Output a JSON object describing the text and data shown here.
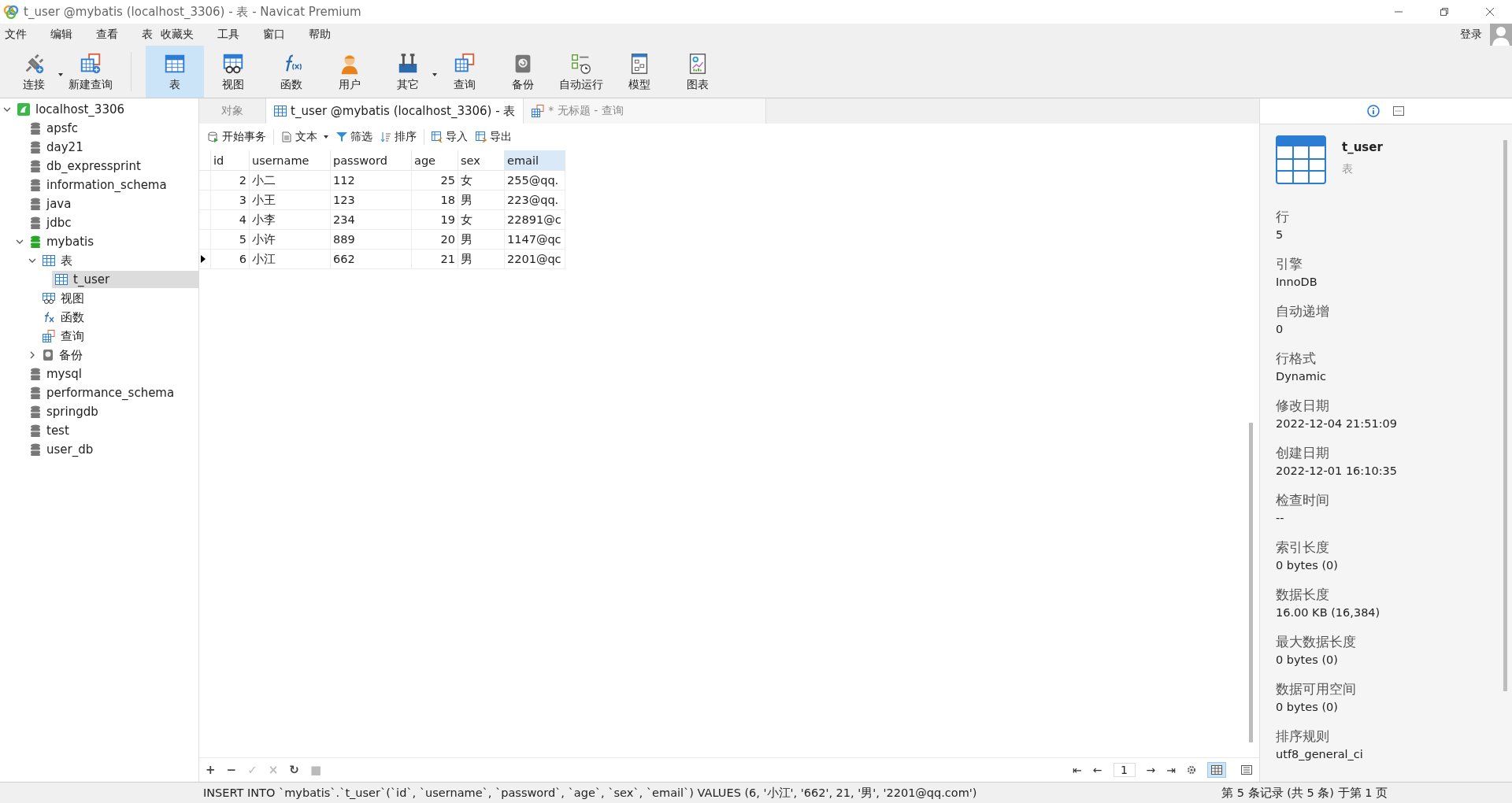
{
  "window": {
    "title": "t_user @mybatis (localhost_3306) - 表 - Navicat Premium"
  },
  "menu": [
    "文件",
    "编辑",
    "查看",
    "表",
    "收藏夹",
    "工具",
    "窗口",
    "帮助"
  ],
  "account": {
    "label": "登录"
  },
  "toolbar": [
    {
      "label": "连接",
      "kind": "connect",
      "selected": false,
      "dropdown": true
    },
    {
      "label": "新建查询",
      "kind": "newquery",
      "selected": false,
      "dropdown": false
    },
    {
      "label": "表",
      "kind": "table",
      "selected": true,
      "dropdown": false
    },
    {
      "label": "视图",
      "kind": "view",
      "selected": false,
      "dropdown": false
    },
    {
      "label": "函数",
      "kind": "function",
      "selected": false,
      "dropdown": false
    },
    {
      "label": "用户",
      "kind": "user",
      "selected": false,
      "dropdown": false
    },
    {
      "label": "其它",
      "kind": "tools",
      "selected": false,
      "dropdown": true
    },
    {
      "label": "查询",
      "kind": "query",
      "selected": false,
      "dropdown": false
    },
    {
      "label": "备份",
      "kind": "backup",
      "selected": false,
      "dropdown": false
    },
    {
      "label": "自动运行",
      "kind": "schedule",
      "selected": false,
      "dropdown": false
    },
    {
      "label": "模型",
      "kind": "model",
      "selected": false,
      "dropdown": false
    },
    {
      "label": "图表",
      "kind": "chart",
      "selected": false,
      "dropdown": false
    }
  ],
  "tree": [
    {
      "label": "localhost_3306",
      "kind": "server",
      "expanded": true,
      "children": [
        {
          "label": "apsfc",
          "kind": "database",
          "active": false,
          "selected": false
        },
        {
          "label": "day21",
          "kind": "database",
          "active": false,
          "selected": false
        },
        {
          "label": "db_expressprint",
          "kind": "database",
          "active": false,
          "selected": false
        },
        {
          "label": "information_schema",
          "kind": "database",
          "active": false,
          "selected": false
        },
        {
          "label": "java",
          "kind": "database",
          "active": false,
          "selected": false
        },
        {
          "label": "jdbc",
          "kind": "database",
          "active": false,
          "selected": false
        },
        {
          "label": "mybatis",
          "kind": "database",
          "active": true,
          "selected": false,
          "expanded": true,
          "children": [
            {
              "label": "表",
              "kind": "tables",
              "expanded": true,
              "selected": false,
              "children": [
                {
                  "label": "t_user",
                  "kind": "table",
                  "selected": true
                }
              ]
            },
            {
              "label": "视图",
              "kind": "views",
              "selected": false
            },
            {
              "label": "函数",
              "kind": "functions",
              "selected": false
            },
            {
              "label": "查询",
              "kind": "queries",
              "selected": false
            },
            {
              "label": "备份",
              "kind": "backups",
              "expanded": false,
              "selected": false
            }
          ]
        },
        {
          "label": "mysql",
          "kind": "database",
          "active": false,
          "selected": false
        },
        {
          "label": "performance_schema",
          "kind": "database",
          "active": false,
          "selected": false
        },
        {
          "label": "springdb",
          "kind": "database",
          "active": false,
          "selected": false
        },
        {
          "label": "test",
          "kind": "database",
          "active": false,
          "selected": false
        },
        {
          "label": "user_db",
          "kind": "database",
          "active": false,
          "selected": false
        }
      ]
    }
  ],
  "tabs": [
    {
      "label": "对象",
      "kind": "objects",
      "selected": false
    },
    {
      "label": "t_user @mybatis (localhost_3306) - 表",
      "kind": "table",
      "selected": true
    },
    {
      "label": "* 无标题 - 查询",
      "kind": "query",
      "selected": false
    }
  ],
  "data_toolbar": [
    {
      "label": "开始事务",
      "kind": "transaction",
      "dropdown": false
    },
    {
      "label": "文本",
      "kind": "text",
      "dropdown": true
    },
    {
      "label": "筛选",
      "kind": "filter",
      "dropdown": false
    },
    {
      "label": "排序",
      "kind": "sort",
      "dropdown": false
    },
    {
      "label": "导入",
      "kind": "import",
      "dropdown": false
    },
    {
      "label": "导出",
      "kind": "export",
      "dropdown": false
    }
  ],
  "grid": {
    "columns": [
      {
        "label": "id",
        "selected": false
      },
      {
        "label": "username",
        "selected": false
      },
      {
        "label": "password",
        "selected": false
      },
      {
        "label": "age",
        "selected": false
      },
      {
        "label": "sex",
        "selected": false
      },
      {
        "label": "email",
        "selected": true
      }
    ],
    "rows": [
      {
        "current": false,
        "cells": [
          "2",
          "小二",
          "112",
          "25",
          "女",
          "255@qq."
        ]
      },
      {
        "current": false,
        "cells": [
          "3",
          "小王",
          "123",
          "18",
          "男",
          "223@qq."
        ]
      },
      {
        "current": false,
        "cells": [
          "4",
          "小李",
          "234",
          "19",
          "女",
          "22891@c"
        ]
      },
      {
        "current": false,
        "cells": [
          "5",
          "小许",
          "889",
          "20",
          "男",
          "1147@qc"
        ]
      },
      {
        "current": true,
        "cells": [
          "6",
          "小江",
          "662",
          "21",
          "男",
          "2201@qc"
        ]
      }
    ]
  },
  "edit_buttons": [
    {
      "symbol": "+",
      "disabled": false
    },
    {
      "symbol": "−",
      "disabled": false
    },
    {
      "symbol": "✓",
      "disabled": true
    },
    {
      "symbol": "×",
      "disabled": true
    },
    {
      "symbol": "↻",
      "disabled": false
    },
    {
      "symbol": "■",
      "disabled": true
    }
  ],
  "pager": {
    "page": "1",
    "buttons": [
      "⇤",
      "←",
      "→",
      "⇥"
    ]
  },
  "view_modes": [
    {
      "kind": "grid",
      "selected": true
    },
    {
      "kind": "form",
      "selected": false
    }
  ],
  "info_tabs": [
    {
      "kind": "info",
      "selected": true
    },
    {
      "kind": "ddl",
      "selected": false
    }
  ],
  "info": {
    "name": "t_user",
    "type": "表",
    "fields": [
      {
        "label": "行",
        "value": "5"
      },
      {
        "label": "引擎",
        "value": "InnoDB"
      },
      {
        "label": "自动递增",
        "value": "0"
      },
      {
        "label": "行格式",
        "value": "Dynamic"
      },
      {
        "label": "修改日期",
        "value": "2022-12-04 21:51:09"
      },
      {
        "label": "创建日期",
        "value": "2022-12-01 16:10:35"
      },
      {
        "label": "检查时间",
        "value": "--"
      },
      {
        "label": "索引长度",
        "value": "0 bytes (0)"
      },
      {
        "label": "数据长度",
        "value": "16.00 KB (16,384)"
      },
      {
        "label": "最大数据长度",
        "value": "0 bytes (0)"
      },
      {
        "label": "数据可用空间",
        "value": "0 bytes (0)"
      },
      {
        "label": "排序规则",
        "value": "utf8_general_ci"
      }
    ]
  },
  "status_bar": {
    "sql": "INSERT INTO `mybatis`.`t_user`(`id`, `username`, `password`, `age`, `sex`, `email`) VALUES (6, '小江', '662', 21, '男', '2201@qq.com')",
    "records": "第 5 条记录 (共 5 条) 于第 1 页"
  }
}
